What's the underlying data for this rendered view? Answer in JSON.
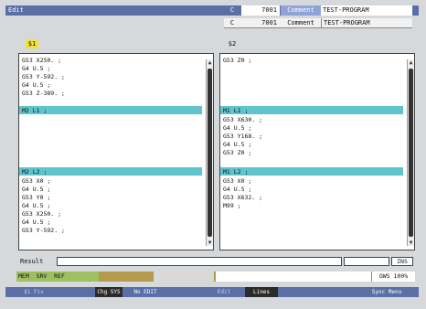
{
  "header": {
    "title": "Edit",
    "row1": {
      "c": "C",
      "number": "7001",
      "comment_label": "Comment",
      "program": "TEST-PROGRAM"
    },
    "row2": {
      "c": "C",
      "number": "7001",
      "comment_label": "Comment",
      "program": "TEST-PROGRAM"
    }
  },
  "systems": {
    "left": "$1",
    "right": "$2"
  },
  "pane1": {
    "lines": [
      "G53 X250. ;",
      "G4 U.5 ;",
      "G53 Y-592. ;",
      "G4 U.5 ;",
      "G53 Z-389. ;",
      "M2 L1 ;",
      "M2 L2 ;",
      "G53 X0 ;",
      "G4 U.5 ;",
      "G53 Y0 ;",
      "G4 U.5 ;",
      "G53 X250. ;",
      "G4 U.5 ;",
      "G53 Y-592. ;"
    ]
  },
  "pane2": {
    "lines": [
      "G53 Z0 ;",
      "M1 L1 ;",
      "G53 X630. ;",
      "G4 U.5 ;",
      "G53 Y168. ;",
      "G4 U.5 ;",
      "G53 Z0 ;",
      "M1 L2 ;",
      "G53 X0 ;",
      "G4 U.5 ;",
      "G53 X632. ;",
      "M99 ;"
    ]
  },
  "result": {
    "label": "Result",
    "insert": "INS"
  },
  "status": {
    "mode": "MEM  SRV  REF",
    "right": "OWS 100%"
  },
  "softkeys": [
    "$1 Fix",
    "Chg SYS",
    "No EDIT",
    "Edit",
    "Lines",
    "",
    "Sync Menu"
  ],
  "colors": {
    "titlebar": "#5a6fa6",
    "highlight": "#5fc4cc",
    "system_label": "#f2e23a",
    "status_green": "#9fc060",
    "status_brown": "#b49a4c"
  }
}
